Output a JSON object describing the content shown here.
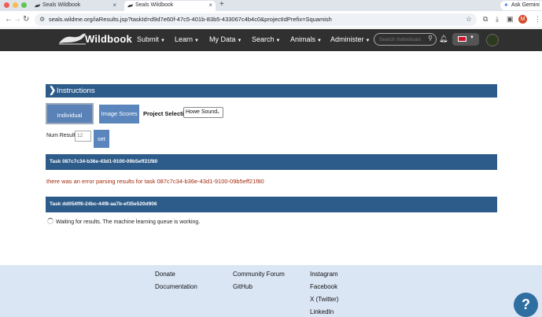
{
  "browser": {
    "tabs": [
      {
        "title": "Seals Wildbook",
        "active": false
      },
      {
        "title": "Seals Wildbook",
        "active": true
      }
    ],
    "new_tab_icon": "+",
    "ask_gemini": "Ask Gemini",
    "url": "seals.wildme.org/iaResults.jsp?taskId=d9d7e60f-47c5-401b-83b5-433067c4b4c0&projectIdPrefix=Squamish",
    "profile_initial": "M"
  },
  "nav": {
    "brand": "Wildbook",
    "items": [
      {
        "label": "Submit"
      },
      {
        "label": "Learn"
      },
      {
        "label": "My Data"
      },
      {
        "label": "Search"
      },
      {
        "label": "Animals"
      },
      {
        "label": "Administer"
      }
    ],
    "search_placeholder": "Search Individuals"
  },
  "main": {
    "instructions_label": "Instructions",
    "btn_individual": "Individual Scores",
    "btn_image": "Image Scores",
    "project_label": "Project Selection",
    "project_value": "Howe Sound",
    "num_results_label": "Num Results:",
    "num_results_value": "12",
    "set_button": "set",
    "task1_label": "Task 087c7c34-b36e-43d1-9100-09b5eff21f80",
    "error_message": "there was an error parsing results for task 087c7c34-b36e-43d1-9100-09b5eff21f80",
    "task2_label": "Task dd054ff6-24bc-44f8-aa7b-ef35e520d906",
    "waiting_message": "Waiting for results. The machine learning queue is working."
  },
  "footer": {
    "col1": [
      "Donate",
      "Documentation"
    ],
    "col2": [
      "Community Forum",
      "GitHub"
    ],
    "col3": [
      "Instagram",
      "Facebook",
      "X (Twitter)",
      "LinkedIn"
    ],
    "help_label": "?"
  },
  "colors": {
    "nav_bg": "#303030",
    "accent_blue": "#2e5c8a",
    "button_blue": "#5b86bd",
    "error_red": "#a2280a",
    "footer_bg": "#dbe6f5"
  }
}
